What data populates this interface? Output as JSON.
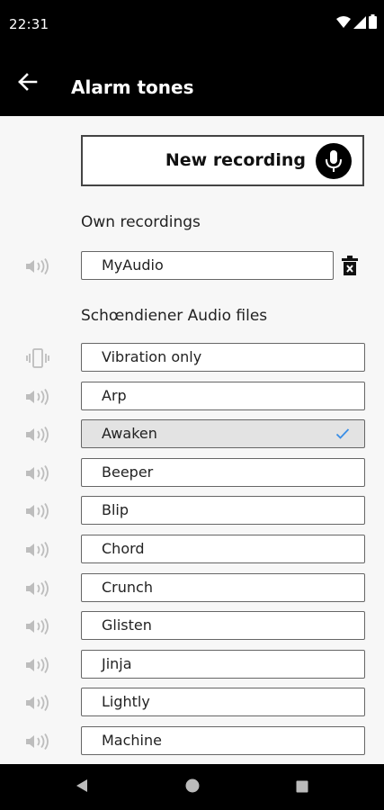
{
  "status_bar": {
    "time": "22:31",
    "icons": [
      "wifi-icon",
      "signal-icon",
      "battery-icon"
    ]
  },
  "app_bar": {
    "title": "Alarm tones",
    "back_icon": "arrow-left-icon"
  },
  "new_recording": {
    "label": "New recording",
    "icon": "microphone-icon"
  },
  "own_recordings": {
    "heading": "Own recordings",
    "items": [
      {
        "label": "MyAudio",
        "icon": "speaker-icon",
        "action_icon": "delete-icon"
      }
    ]
  },
  "audio_files": {
    "heading": "Schœndiener Audio files",
    "items": [
      {
        "label": "Vibration only",
        "icon": "vibration-icon",
        "selected": false
      },
      {
        "label": "Arp",
        "icon": "speaker-icon",
        "selected": false
      },
      {
        "label": "Awaken",
        "icon": "speaker-icon",
        "selected": true
      },
      {
        "label": "Beeper",
        "icon": "speaker-icon",
        "selected": false
      },
      {
        "label": "Blip",
        "icon": "speaker-icon",
        "selected": false
      },
      {
        "label": "Chord",
        "icon": "speaker-icon",
        "selected": false
      },
      {
        "label": "Crunch",
        "icon": "speaker-icon",
        "selected": false
      },
      {
        "label": "Glisten",
        "icon": "speaker-icon",
        "selected": false
      },
      {
        "label": "Jinja",
        "icon": "speaker-icon",
        "selected": false
      },
      {
        "label": "Lightly",
        "icon": "speaker-icon",
        "selected": false
      },
      {
        "label": "Machine",
        "icon": "speaker-icon",
        "selected": false
      }
    ]
  },
  "nav_bar": {
    "buttons": [
      "back-triangle-icon",
      "home-circle-icon",
      "recents-square-icon"
    ]
  },
  "colors": {
    "bar_background": "#000000",
    "page_background": "#f7f7f7",
    "selected_row": "#e3e3e3",
    "check_mark": "#3a8ee6"
  }
}
